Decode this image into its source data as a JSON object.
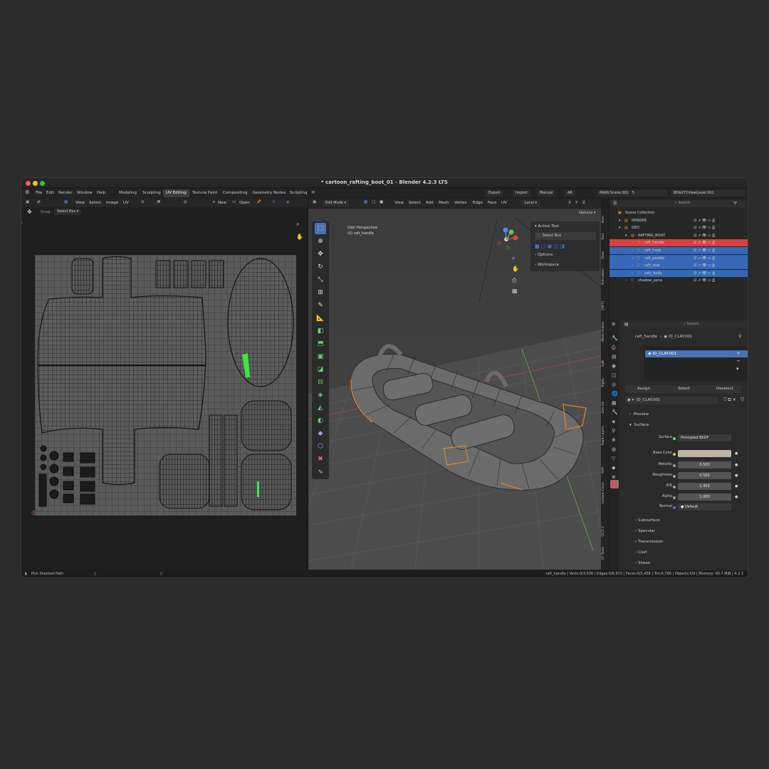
{
  "window": {
    "title": "* cartoon_rafting_boot_01 - Blender 4.2.3 LTS",
    "menus": [
      "File",
      "Edit",
      "Render",
      "Window",
      "Help"
    ],
    "workspaces": [
      "Modeling",
      "Sculpting",
      "UV Editing",
      "Texture Paint",
      "Compositing",
      "Geometry Nodes",
      "Scripting"
    ],
    "active_workspace": "UV Editing",
    "export": "Export",
    "import": "Import",
    "manual": "Manual",
    "ar": "AR",
    "scene": "MAIN.Scene.001",
    "scene_count": "5",
    "view_layer": "BEAUTY.ViewLayer.001"
  },
  "uv_editor": {
    "menus": [
      "View",
      "Select",
      "Image",
      "UV"
    ],
    "new": "New",
    "open": "Open",
    "tool_drag": "Drag",
    "tool_select": "Select Box"
  },
  "viewport": {
    "mode": "Edit Mode",
    "menus": [
      "View",
      "Select",
      "Add",
      "Mesh",
      "Vertex",
      "Edge",
      "Face",
      "UV"
    ],
    "orientation": "Local",
    "axes": [
      "X",
      "Y",
      "Z"
    ],
    "options": "Options",
    "perspective": "User Perspective",
    "object": "(0) raft_handle",
    "npanel": {
      "active_tool": "Active Tool",
      "select_box": "Select Box",
      "options": "Options",
      "workspace": "Workspace"
    },
    "side_tabs": [
      "Item",
      "Tool",
      "View",
      "Animation",
      "[MFT]",
      "Mesh Online",
      "Edit",
      "Rigify",
      "Zen UV",
      "Paint Layers",
      "ARP",
      "Instant Clean",
      "OCD 2",
      "VF Tools"
    ]
  },
  "outliner": {
    "search_placeholder": "Search",
    "rows": [
      {
        "label": "Scene Collection",
        "indent": 0,
        "state": "normal"
      },
      {
        "label": "RENDER",
        "indent": 1,
        "state": "normal"
      },
      {
        "label": "GEO",
        "indent": 1,
        "state": "normal"
      },
      {
        "label": "RAFTING_BOOT",
        "indent": 2,
        "state": "normal"
      },
      {
        "label": "raft_handle",
        "indent": 3,
        "state": "active"
      },
      {
        "label": "raft_hook",
        "indent": 3,
        "state": "selected"
      },
      {
        "label": "raft_paddle",
        "indent": 3,
        "state": "selected"
      },
      {
        "label": "raft_seat",
        "indent": 3,
        "state": "selected"
      },
      {
        "label": "rafy_body",
        "indent": 3,
        "state": "selected"
      },
      {
        "label": "shadow_pane",
        "indent": 2,
        "state": "normal"
      }
    ]
  },
  "properties": {
    "search_placeholder": "Search",
    "object": "raft_handle",
    "material": "ID_CLAY.001",
    "slot": "ID_CLAY.001",
    "assign": "Assign",
    "select": "Select",
    "deselect": "Deselect",
    "material_field": "ID_CLAY.001",
    "preview": "Preview",
    "surface": "Surface",
    "surface_label": "Surface",
    "surface_value": "Principled BSDF",
    "base_color_label": "Base Color",
    "base_color": "#bdb5a5",
    "params": [
      {
        "label": "Metallic",
        "value": "0.500"
      },
      {
        "label": "Roughness",
        "value": "0.500"
      },
      {
        "label": "IOR",
        "value": "1.450"
      },
      {
        "label": "Alpha",
        "value": "1.000"
      }
    ],
    "normal_label": "Normal",
    "normal_value": "Default",
    "subpanels": [
      "Subsurface",
      "Specular",
      "Transmission",
      "Coat",
      "Sheen"
    ]
  },
  "status": {
    "left": "Pick Shortest Path",
    "right": "raft_handle | Verts:0/3,536 | Edges:0/6,972 | Faces:0/3,458 | Tris:6,766 | Objects:5/9 | Memory: 90.7 MiB | 4.2.3"
  },
  "colors": {
    "accent": "#4772b3",
    "active_row": "#d54141",
    "selected_row": "#3568b8",
    "uv_selected": "#3de83d",
    "edge_highlight": "#e0862b"
  }
}
